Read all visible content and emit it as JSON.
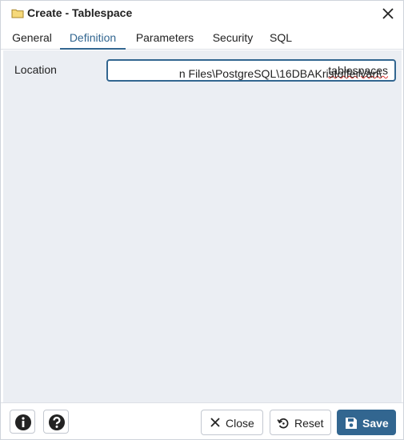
{
  "window": {
    "title": "Create - Tablespace"
  },
  "tabs": [
    {
      "label": "General"
    },
    {
      "label": "Definition",
      "active": true
    },
    {
      "label": "Parameters"
    },
    {
      "label": "Security"
    },
    {
      "label": "SQL"
    }
  ],
  "definition": {
    "location_label": "Location",
    "location_value_plain": "n Files\\PostgreSQL\\16DBAKristofferVan\\",
    "location_value_flagged": "tablespaces"
  },
  "footer": {
    "info_icon": "info-icon",
    "help_icon": "help-icon",
    "close_label": "Close",
    "reset_label": "Reset",
    "save_label": "Save"
  },
  "colors": {
    "accent": "#326690",
    "panel_bg": "#ebeef3"
  }
}
